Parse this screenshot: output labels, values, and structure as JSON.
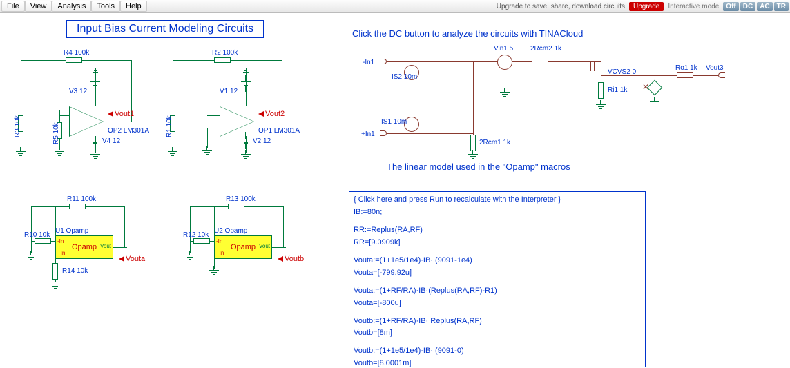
{
  "toolbar": {
    "menus": [
      "File",
      "View",
      "Analysis",
      "Tools",
      "Help"
    ],
    "upgrade_msg": "Upgrade to save, share, download circuits",
    "upgrade_btn": "Upgrade",
    "interactive": "Interactive mode",
    "modes": [
      "Off",
      "DC",
      "AC",
      "TR"
    ]
  },
  "title": "Input Bias Current Modeling Circuits",
  "subtitle1": "Click the DC button to analyze the circuits with TINACloud",
  "subtitle2": "The linear model used in the \"Opamp\" macros",
  "c1": {
    "R4": "R4 100k",
    "R3": "R3 10k",
    "R5": "R5 10k",
    "V3": "V3 12",
    "V4": "V4 12",
    "op": "OP2 LM301A",
    "vout": "Vout1"
  },
  "c2": {
    "R2": "R2 100k",
    "R1": "R1 10k",
    "V1": "V1 12",
    "V2": "V2 12",
    "op": "OP1 LM301A",
    "vout": "Vout2"
  },
  "c3": {
    "R11": "R11 100k",
    "R10": "R10 10k",
    "R14": "R14 10k",
    "U": "U1 Opamp",
    "blk": "Opamp",
    "in1": "-In",
    "in2": "+In",
    "out": "Vout",
    "probe": "Vouta"
  },
  "c4": {
    "R13": "R13 100k",
    "R12": "R12 10k",
    "U": "U2 Opamp",
    "blk": "Opamp",
    "in1": "-In",
    "in2": "+In",
    "out": "Vout",
    "probe": "Voutb"
  },
  "right": {
    "Vin": "Vin1 5",
    "R2Rcm2": "2Rcm2 1k",
    "VCVS": "VCVS2 0",
    "Ro1": "Ro1 1k",
    "Vout3": "Vout3",
    "Ri1": "Ri1 1k",
    "IS2": "IS2 10m",
    "IS1": "IS1 10m",
    "R2Rcm1": "2Rcm1 1k",
    "inN": "-In1",
    "inP": "+In1"
  },
  "interp": {
    "l0": "{ Click here and press Run to recalculate with the Interpreter }",
    "l1": "IB:=80n;",
    "l2": "RR:=Replus(RA,RF)",
    "l3": "RR=[9.0909k]",
    "l4": "Vouta:=(1+1e5/1e4)·IB· (9091-1e4)",
    "l5": "Vouta=[-799.92u]",
    "l6": "Vouta:=(1+RF/RA)·IB·(Replus(RA,RF)-R1)",
    "l7": "Vouta=[-800u]",
    "l8": "Voutb:=(1+RF/RA)·IB· Replus(RA,RF)",
    "l9": "Voutb=[8m]",
    "l10": "Voutb:=(1+1e5/1e4)·IB· (9091-0)",
    "l11": "Voutb=[8.0001m]"
  }
}
